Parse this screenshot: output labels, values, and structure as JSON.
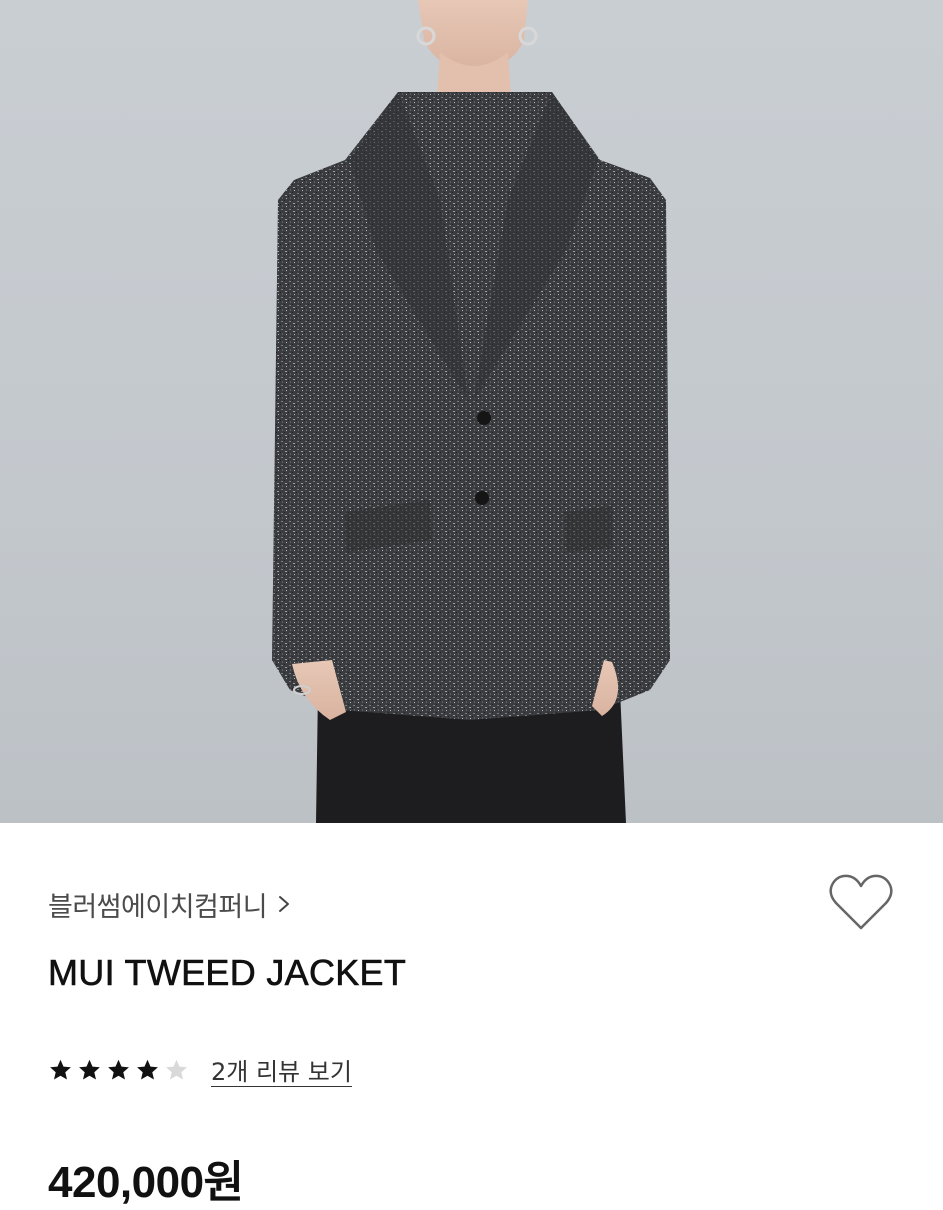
{
  "product_image": {
    "icon": "product-photo-tweed-jacket"
  },
  "brand": {
    "name": "블러썸에이치컴퍼니",
    "chevron_icon": "chevron-right-icon"
  },
  "like": {
    "icon": "heart-outline-icon"
  },
  "product": {
    "title": "MUI TWEED JACKET",
    "price": "420,000원"
  },
  "rating": {
    "value": 4,
    "max": 5,
    "filled_color": "#111111",
    "empty_color": "#d9d9d9",
    "review_link": "2개 리뷰 보기"
  }
}
